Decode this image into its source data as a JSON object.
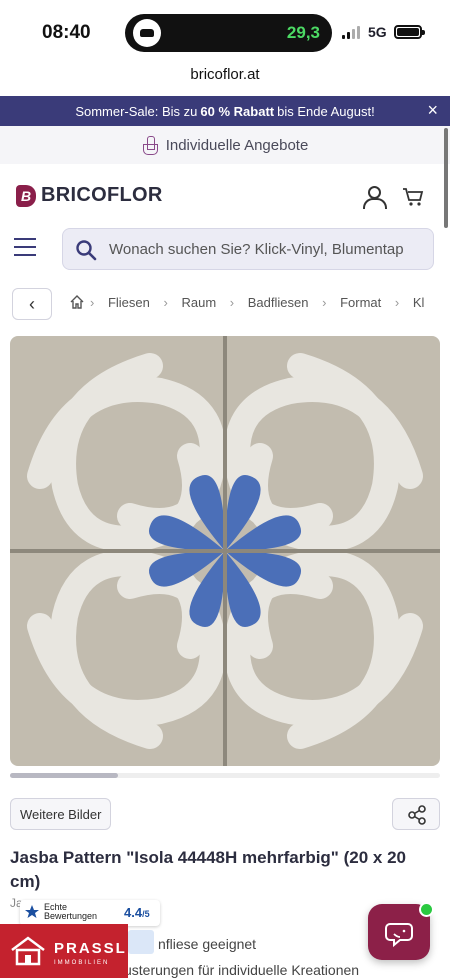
{
  "status_bar": {
    "time": "08:40",
    "activity_value": "29,3",
    "network": "5G"
  },
  "browser": {
    "url": "bricoflor.at"
  },
  "promo": {
    "text_before": "Sommer-Sale: Bis zu",
    "highlight": "60 % Rabatt",
    "text_after": "bis Ende August!",
    "close_symbol": "×"
  },
  "offers": {
    "label": "Individuelle Angebote"
  },
  "header": {
    "logo_mark": "B",
    "logo_text": "BRICOFLOR"
  },
  "search": {
    "placeholder": "Wonach suchen Sie? Klick-Vinyl, Blumentap"
  },
  "breadcrumb": {
    "back_symbol": "‹",
    "items": [
      "Fliesen",
      "Raum",
      "Badfliesen",
      "Format",
      "Kl"
    ]
  },
  "product": {
    "more_images_label": "Weitere Bilder",
    "title": "Jasba Pattern \"Isola 44448H mehrfarbig\" (20 x 20 cm)",
    "subtitle_partial": "Ja",
    "feature_1": "nfliese geeignet",
    "feature_2": "usterungen für individuelle Kreationen"
  },
  "rating_badge": {
    "label_line1": "Echte",
    "label_line2": "Bewertungen",
    "score": "4.4",
    "scale": "/5"
  },
  "prassl": {
    "name": "PRASSL",
    "sub": "IMMOBILIEN"
  },
  "colors": {
    "promo_bg": "#3a3b79",
    "brand": "#8a1f4a",
    "tile_blue": "#4b6fb8",
    "tile_beige": "#c2bcaf",
    "tile_dark": "#5c5a52"
  }
}
